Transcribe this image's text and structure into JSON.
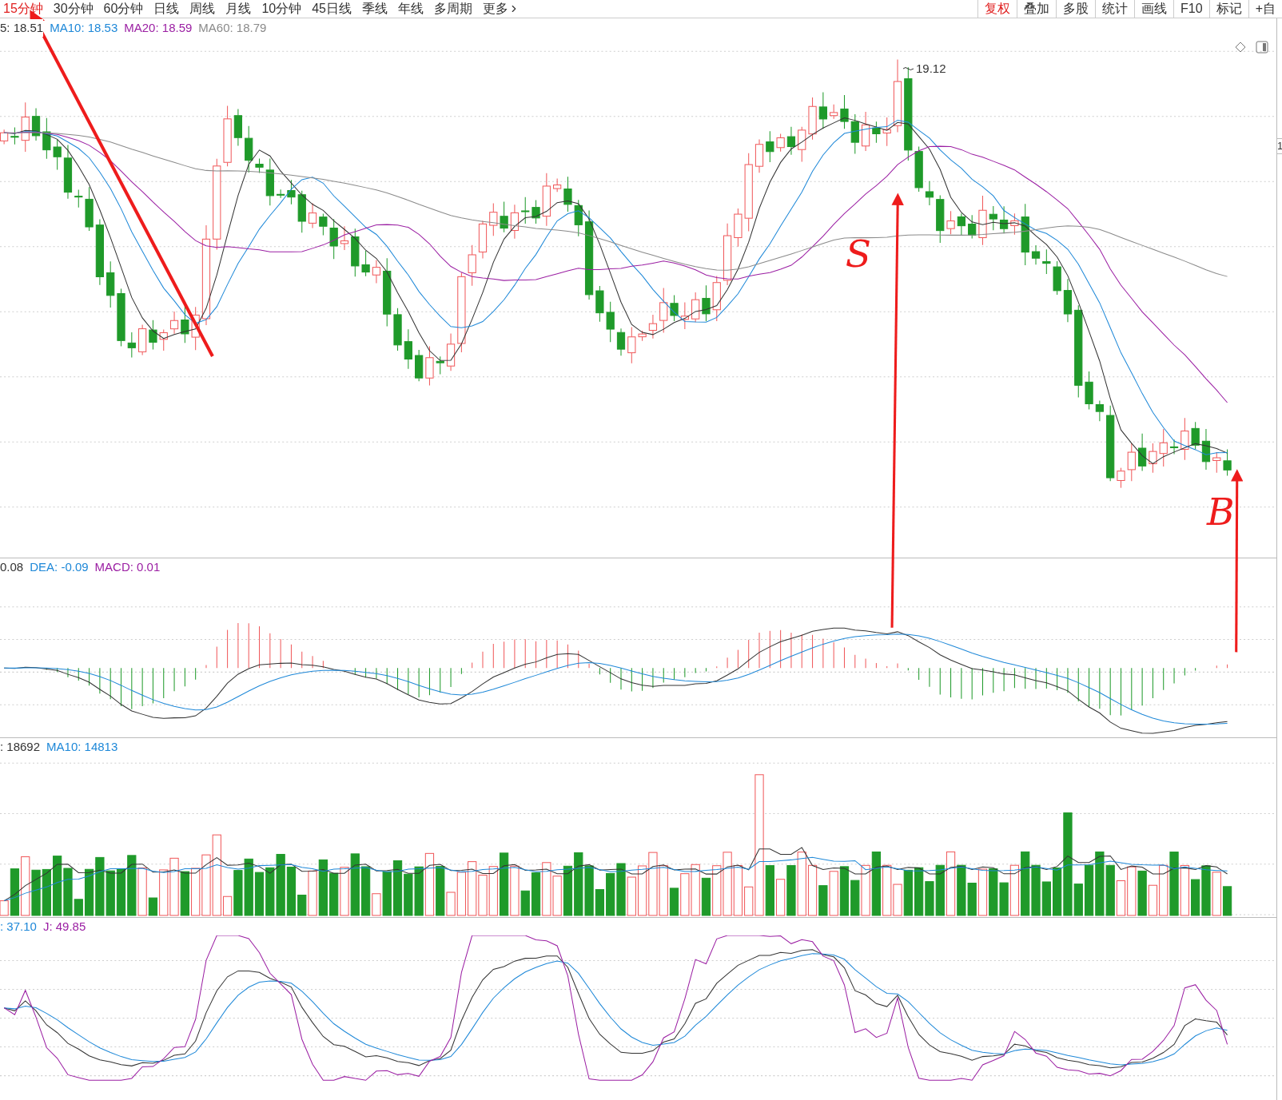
{
  "toolbar": {
    "periods": [
      {
        "label": "15分钟",
        "selected": true,
        "kind": "period"
      },
      {
        "label": "30分钟",
        "selected": false,
        "kind": "period"
      },
      {
        "label": "60分钟",
        "selected": false,
        "kind": "period"
      },
      {
        "label": "日线",
        "selected": false,
        "kind": "period"
      },
      {
        "label": "周线",
        "selected": false,
        "kind": "period"
      },
      {
        "label": "月线",
        "selected": false,
        "kind": "period"
      },
      {
        "label": "10分钟",
        "selected": false,
        "kind": "period"
      },
      {
        "label": "45日线",
        "selected": false,
        "kind": "period"
      },
      {
        "label": "季线",
        "selected": false,
        "kind": "period"
      },
      {
        "label": "年线",
        "selected": false,
        "kind": "period"
      },
      {
        "label": "多周期",
        "selected": false,
        "kind": "period"
      },
      {
        "label": "更多",
        "selected": false,
        "kind": "more"
      }
    ],
    "tools": [
      {
        "label": "复权",
        "selected": true
      },
      {
        "label": "叠加",
        "selected": false
      },
      {
        "label": "多股",
        "selected": false
      },
      {
        "label": "统计",
        "selected": false
      },
      {
        "label": "画线",
        "selected": false
      },
      {
        "label": "F10",
        "selected": false
      },
      {
        "label": "标记",
        "selected": false
      },
      {
        "label": "+自",
        "selected": false
      }
    ]
  },
  "main_panel": {
    "legend": [
      {
        "text": "5: 18.51",
        "color": "#333333"
      },
      {
        "text": "MA10: 18.53",
        "color": "#1e88d8"
      },
      {
        "text": "MA20: 18.59",
        "color": "#9b1fa3"
      },
      {
        "text": "MA60: 18.79",
        "color": "#8a8a8a"
      }
    ],
    "high_label": "19.12",
    "right_axis_label": "1"
  },
  "macd_panel": {
    "legend": [
      {
        "text": "0.08",
        "color": "#333333"
      },
      {
        "text": "DEA: -0.09",
        "color": "#1e88d8"
      },
      {
        "text": "MACD: 0.01",
        "color": "#9b1fa3"
      }
    ]
  },
  "volume_panel": {
    "legend": [
      {
        "text": ": 18692",
        "color": "#333333"
      },
      {
        "text": "MA10: 14813",
        "color": "#1e88d8"
      }
    ]
  },
  "kdj_panel": {
    "legend": [
      {
        "text": ": 37.10",
        "color": "#1e88d8"
      },
      {
        "text": "J: 49.85",
        "color": "#9b1fa3"
      }
    ]
  },
  "annotations": [
    {
      "text": "S"
    },
    {
      "text": "B"
    }
  ]
}
